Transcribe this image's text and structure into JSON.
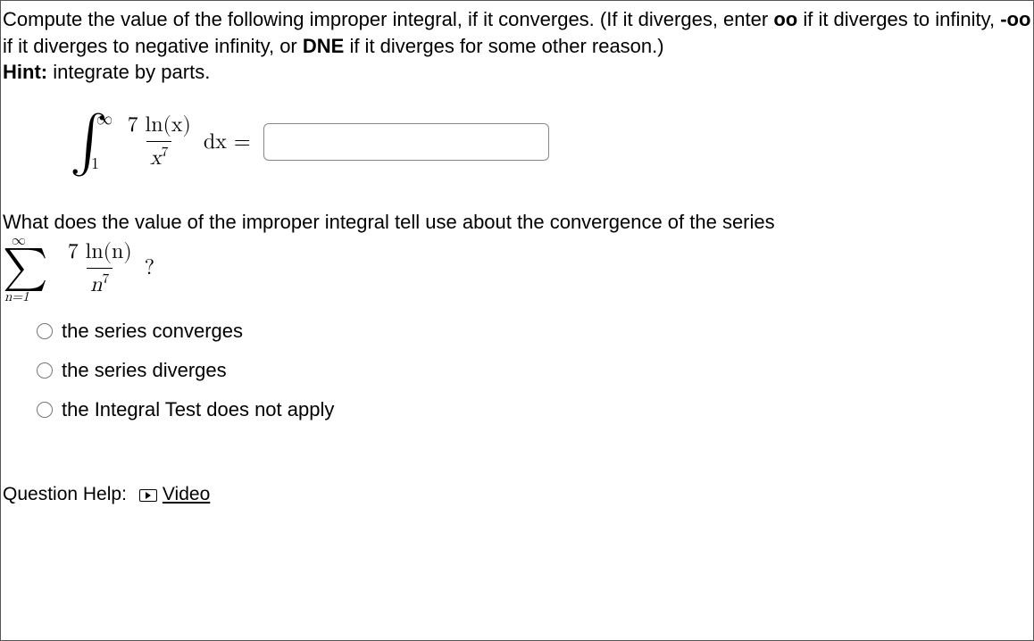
{
  "prompt": {
    "line1a": "Compute the value of the following improper integral, if it converges. (If it diverges, enter ",
    "line1b": "oo",
    "line1c": " if it diverges to infinity, ",
    "line1d": "-oo",
    "line1e": " if it diverges to negative infinity, or ",
    "line1f": "DNE",
    "line1g": " if it diverges for some other reason.) ",
    "line2a": "Hint:",
    "line2b": " integrate by parts."
  },
  "integral": {
    "upper": "∞",
    "lower": "1",
    "numerator": "7 ln(x)",
    "denom_base": "x",
    "denom_exp": "7",
    "dx_eq": "dx  ="
  },
  "answer_value": "",
  "question2": {
    "lead": "What does the value of the improper integral tell use about the convergence of the series",
    "sigma_upper": "∞",
    "sigma_lower": "n=1",
    "numerator": "7 ln(n)",
    "denom_base": "n",
    "denom_exp": "7",
    "qmark": "?"
  },
  "options": [
    "the series converges",
    "the series diverges",
    "the Integral Test does not apply"
  ],
  "help": {
    "label": "Question Help:",
    "video": "Video"
  }
}
